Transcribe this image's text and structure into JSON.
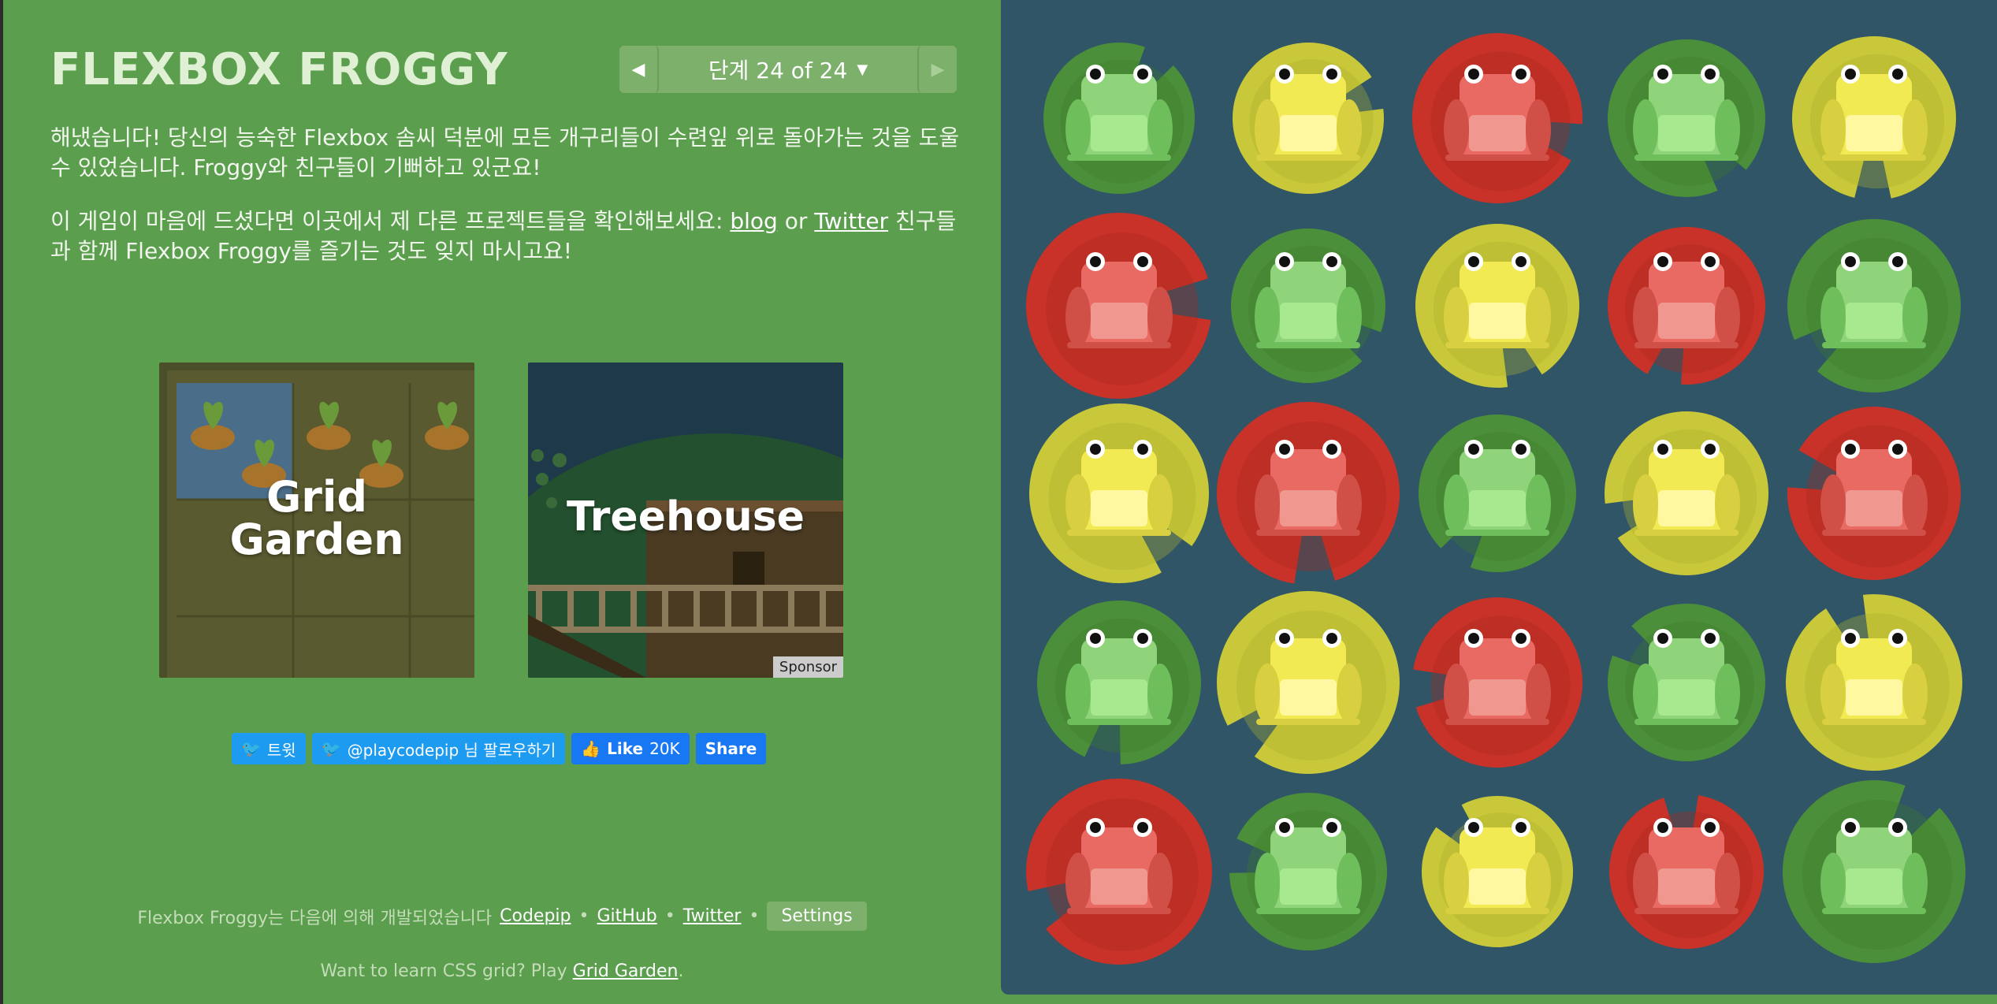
{
  "header": {
    "title": "FLEXBOX FROGGY",
    "level_label": "단계 24 of 24"
  },
  "paragraphs": {
    "completion": "해냈습니다! 당신의 능숙한 Flexbox 솜씨 덕분에 모든 개구리들이 수련잎 위로 돌아가는 것을 도울 수 있었습니다. Froggy와 친구들이 기뻐하고 있군요!",
    "promo_before": "이 게임이 마음에 드셨다면 이곳에서 제 다른 프로젝트들을 확인해보세요: ",
    "blog_link": "blog",
    "or_text": " or ",
    "twitter_link": "Twitter",
    "promo_after": " 친구들과 함께 Flexbox Froggy를 즐기는 것도 잊지 마시고요!"
  },
  "cards": {
    "grid_garden_line1": "Grid",
    "grid_garden_line2": "Garden",
    "treehouse": "Treehouse",
    "sponsor": "Sponsor"
  },
  "social": {
    "tweet": "트윗",
    "follow": "@playcodepip 님 팔로우하기",
    "like": "Like",
    "like_count": "20K",
    "share": "Share"
  },
  "footer": {
    "dev_text": "Flexbox Froggy는 다음에 의해 개발되었습니다",
    "codepip": "Codepip",
    "github": "GitHub",
    "twitter": "Twitter",
    "settings": "Settings",
    "grid_prefix": "Want to learn CSS grid? Play ",
    "grid_link": "Grid Garden",
    "grid_suffix": "."
  },
  "pond": {
    "rows": [
      [
        "green",
        "yellow",
        "red",
        "green",
        "yellow"
      ],
      [
        "red",
        "green",
        "yellow",
        "red",
        "green"
      ],
      [
        "yellow",
        "red",
        "green",
        "yellow",
        "red"
      ],
      [
        "green",
        "yellow",
        "red",
        "green",
        "yellow"
      ],
      [
        "red",
        "green",
        "yellow",
        "red",
        "green"
      ]
    ]
  },
  "colors": {
    "sidebar_bg": "#5a9e4e",
    "pond_bg": "#2f5566",
    "green_pad": "#4c8f3a",
    "yellow_pad": "#c8c83a",
    "red_pad": "#c83228",
    "green_frog": "#8fd47a",
    "yellow_frog": "#f2ea52",
    "red_frog": "#e86a62"
  }
}
